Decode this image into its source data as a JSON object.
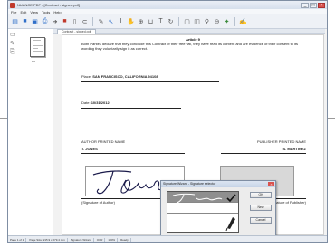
{
  "window": {
    "title": "NUANCE PDF - [Contract - signed.pdf]"
  },
  "menu": [
    "File",
    "Edit",
    "View",
    "Tools",
    "Help"
  ],
  "document": {
    "tab_label": "Contract - signed.pdf",
    "thumbnail_label": "1/1",
    "article_title": "Article 9",
    "intro_text": "Both Parties declare that they conclude this Contract of their free will, they have read its content and are evidence of their consent to its wording they voluntarily sign it as correct.",
    "place_label": "Place:",
    "place_value": "SAN FRANCISCO, CALIFORNIA 94108",
    "date_label": "Date:",
    "date_value": "10/31/2012",
    "author_heading": "AUTHOR PRINTED NAME",
    "publisher_heading": "PUBLISHER PRINTED NAME",
    "author_name": "T. JONES",
    "publisher_name": "S. MARTINEZ",
    "author_signature_caption": "(Signature of Author)",
    "publisher_signature_caption": "(Signature of Publisher)"
  },
  "dialog": {
    "title": "Signature Wizard - Signature selector",
    "ok_label": "OK",
    "new_label": "New",
    "cancel_label": "Cancel"
  },
  "status": [
    "Page 1 of 1",
    "Page Size: 215.9 x 279.4 mm",
    "Signature Wizard",
    "OCR",
    "100%",
    "Ready"
  ],
  "colors": {
    "accent": "#2f6fc9",
    "dialog_selected_row": "#8f8f8f",
    "publisher_box": "#d8d8d8"
  }
}
